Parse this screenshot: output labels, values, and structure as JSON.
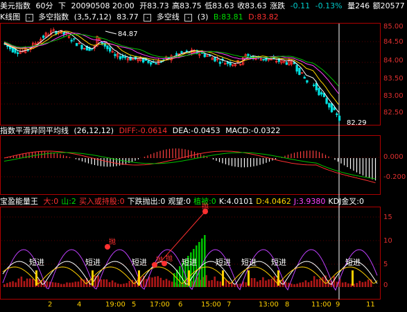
{
  "header": {
    "title": "美元指数",
    "period": "60分",
    "direction": "下",
    "datetime": "20090508  20:00",
    "open": "开83.73",
    "high": "高83.75",
    "low": "低83.63",
    "close": "收83.63",
    "change_label": "涨跌",
    "change": "-0.11",
    "change_pct": "-0.13%",
    "volume": "量246",
    "amount": "额20577"
  },
  "main_indicator": {
    "label": "K线图",
    "selector": "多空指数",
    "params": "(3,5,7,12)",
    "value": "83.77",
    "selector2": "多空线",
    "params2": "(3)",
    "b_value": "B:83.81",
    "d_value": "D:83.82",
    "peak_label": "84.87",
    "trough_label": "82.29",
    "axis_ticks": [
      "85.00",
      "84.50",
      "84.00",
      "83.50",
      "83.00",
      "82.50"
    ]
  },
  "macd": {
    "label": "指数平滑异同平均线",
    "params": "(26,12,12)",
    "diff": "DIFF:-0.0614",
    "dea": "DEA:-0.0453",
    "macd": "MACD:-0.0322",
    "axis_ticks": [
      "0.000",
      "-0.200"
    ]
  },
  "energy": {
    "label": "宝盈能量王",
    "items": [
      {
        "text": "大:0",
        "color": "#ff3030"
      },
      {
        "text": "山:2",
        "color": "#00dd00"
      },
      {
        "text": "买入或持股:0",
        "color": "#ff3030"
      },
      {
        "text": "下跌抛出:0",
        "color": "#ffffff"
      },
      {
        "text": "观望:0",
        "color": "#ffffff"
      },
      {
        "text": "植被:0",
        "color": "#00dd00"
      },
      {
        "text": "K:4.0101",
        "color": "#ffffff"
      },
      {
        "text": "D:4.0462",
        "color": "#ffd700"
      },
      {
        "text": "J:3.9380",
        "color": "#ff44ff"
      },
      {
        "text": "KDJ金叉:0",
        "color": "#ffffff"
      }
    ],
    "axis_ticks": [
      "15",
      "10",
      "5",
      "0"
    ],
    "labels_short": [
      "短进",
      "短进",
      "短进",
      "短进",
      "短进",
      "短进",
      "短进",
      "短进"
    ],
    "labels_sell": [
      "抛",
      "抛",
      "抛"
    ],
    "label_top": "抛"
  },
  "time_axis": [
    "2",
    "4",
    "19:00",
    "5",
    "17:00",
    "6",
    "15:00",
    "7",
    "13:00",
    "8",
    "11:00",
    "9",
    "11"
  ]
}
